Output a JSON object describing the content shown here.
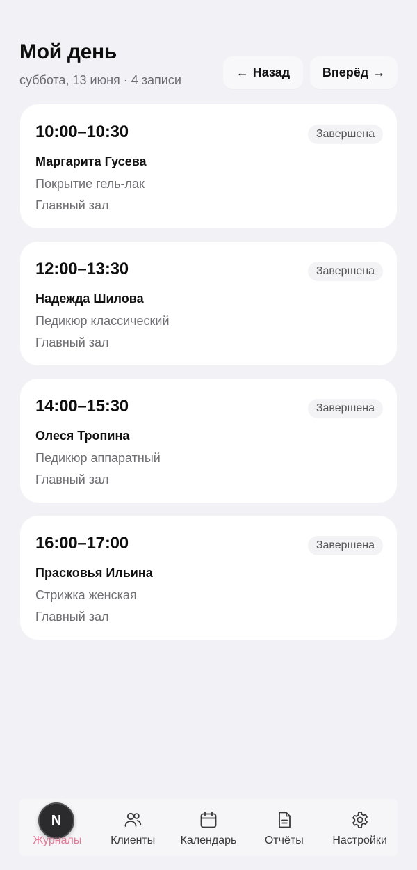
{
  "header": {
    "title": "Мой день",
    "subtitle": "суббота, 13 июня · 4 записи",
    "back_label": "Назад",
    "forward_label": "Вперёд",
    "back_arrow": "←",
    "forward_arrow": "→"
  },
  "appointments": [
    {
      "time": "10:00–10:30",
      "status": "Завершена",
      "client": "Маргарита Гусева",
      "service": "Покрытие гель-лак",
      "room": "Главный зал"
    },
    {
      "time": "12:00–13:30",
      "status": "Завершена",
      "client": "Надежда Шилова",
      "service": "Педикюр классический",
      "room": "Главный зал"
    },
    {
      "time": "14:00–15:30",
      "status": "Завершена",
      "client": "Олеся Тропина",
      "service": "Педикюр аппаратный",
      "room": "Главный зал"
    },
    {
      "time": "16:00–17:00",
      "status": "Завершена",
      "client": "Прасковья Ильина",
      "service": "Стрижка женская",
      "room": "Главный зал"
    }
  ],
  "tabbar": {
    "badge_letter": "N",
    "tabs": [
      {
        "label": "Журналы",
        "icon": "journal-icon",
        "active": true
      },
      {
        "label": "Клиенты",
        "icon": "users-icon",
        "active": false
      },
      {
        "label": "Календарь",
        "icon": "calendar-icon",
        "active": false
      },
      {
        "label": "Отчёты",
        "icon": "report-icon",
        "active": false
      },
      {
        "label": "Настройки",
        "icon": "gear-icon",
        "active": false
      }
    ]
  },
  "colors": {
    "background": "#f2f1f6",
    "card": "#ffffff",
    "accent_active_tab": "#e27a98",
    "badge_bg": "#f3f3f5"
  }
}
